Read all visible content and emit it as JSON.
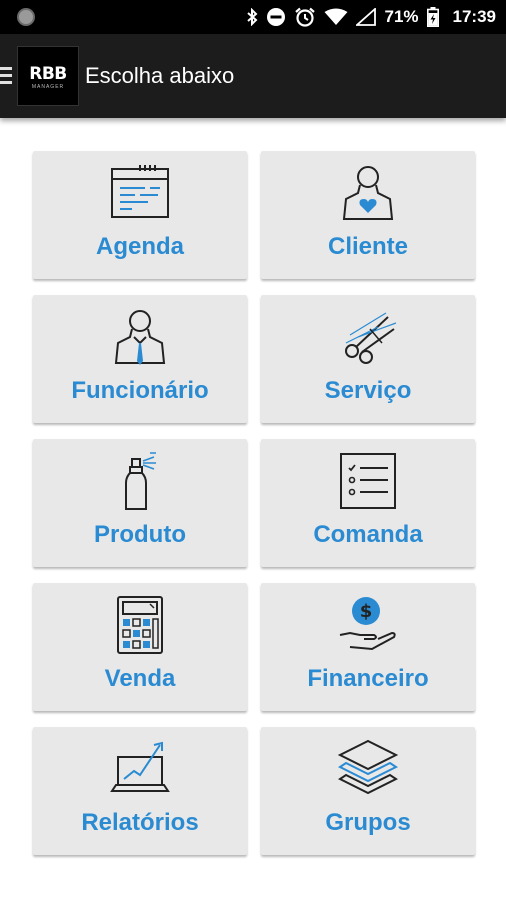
{
  "status_bar": {
    "battery_percent": "71%",
    "time": "17:39",
    "icons": [
      "notification-dot-icon",
      "bluetooth-icon",
      "do-not-disturb-icon",
      "alarm-icon",
      "wifi-icon",
      "signal-icon",
      "battery-icon"
    ]
  },
  "app_bar": {
    "logo_text": "RBB",
    "logo_subtext": "MANAGER",
    "title": "Escolha abaixo"
  },
  "tiles": [
    {
      "label": "Agenda",
      "icon": "calendar-icon"
    },
    {
      "label": "Cliente",
      "icon": "client-heart-icon"
    },
    {
      "label": "Funcionário",
      "icon": "employee-tie-icon"
    },
    {
      "label": "Serviço",
      "icon": "scissors-icon"
    },
    {
      "label": "Produto",
      "icon": "spray-bottle-icon"
    },
    {
      "label": "Comanda",
      "icon": "checklist-icon"
    },
    {
      "label": "Venda",
      "icon": "calculator-icon"
    },
    {
      "label": "Financeiro",
      "icon": "money-hand-icon"
    },
    {
      "label": "Relatórios",
      "icon": "laptop-chart-icon"
    },
    {
      "label": "Grupos",
      "icon": "layers-icon"
    }
  ],
  "colors": {
    "accent": "#2a8bd2",
    "tile_bg": "#e8e8e8",
    "app_bar_bg": "#1c1c1c",
    "icon_stroke": "#222222"
  }
}
